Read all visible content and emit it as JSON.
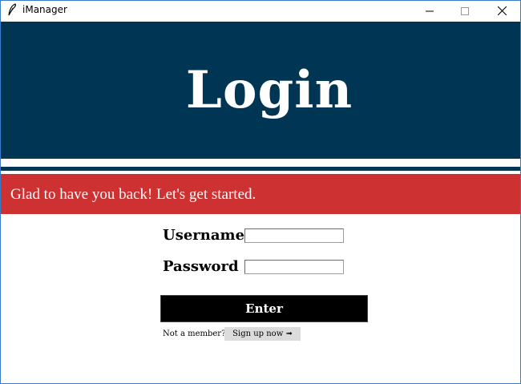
{
  "window": {
    "title": "iManager",
    "controls": {
      "minimize": "—",
      "maximize": "☐",
      "close": "✕"
    }
  },
  "header": {
    "title": "Login"
  },
  "banner": {
    "message": "Glad to have you back! Let's get started."
  },
  "form": {
    "username_label": "Username",
    "username_value": "",
    "password_label": "Password",
    "password_value": "",
    "enter_label": "Enter",
    "not_member_text": "Not a member?",
    "signup_label": "Sign up now ➟"
  },
  "colors": {
    "header_bg": "#013554",
    "banner_bg": "#cd3131",
    "button_bg": "#000000",
    "signup_bg": "#dcdcdc"
  },
  "icons": {
    "app": "feather-icon",
    "minimize": "minimize-icon",
    "maximize": "maximize-icon",
    "close": "close-icon"
  }
}
